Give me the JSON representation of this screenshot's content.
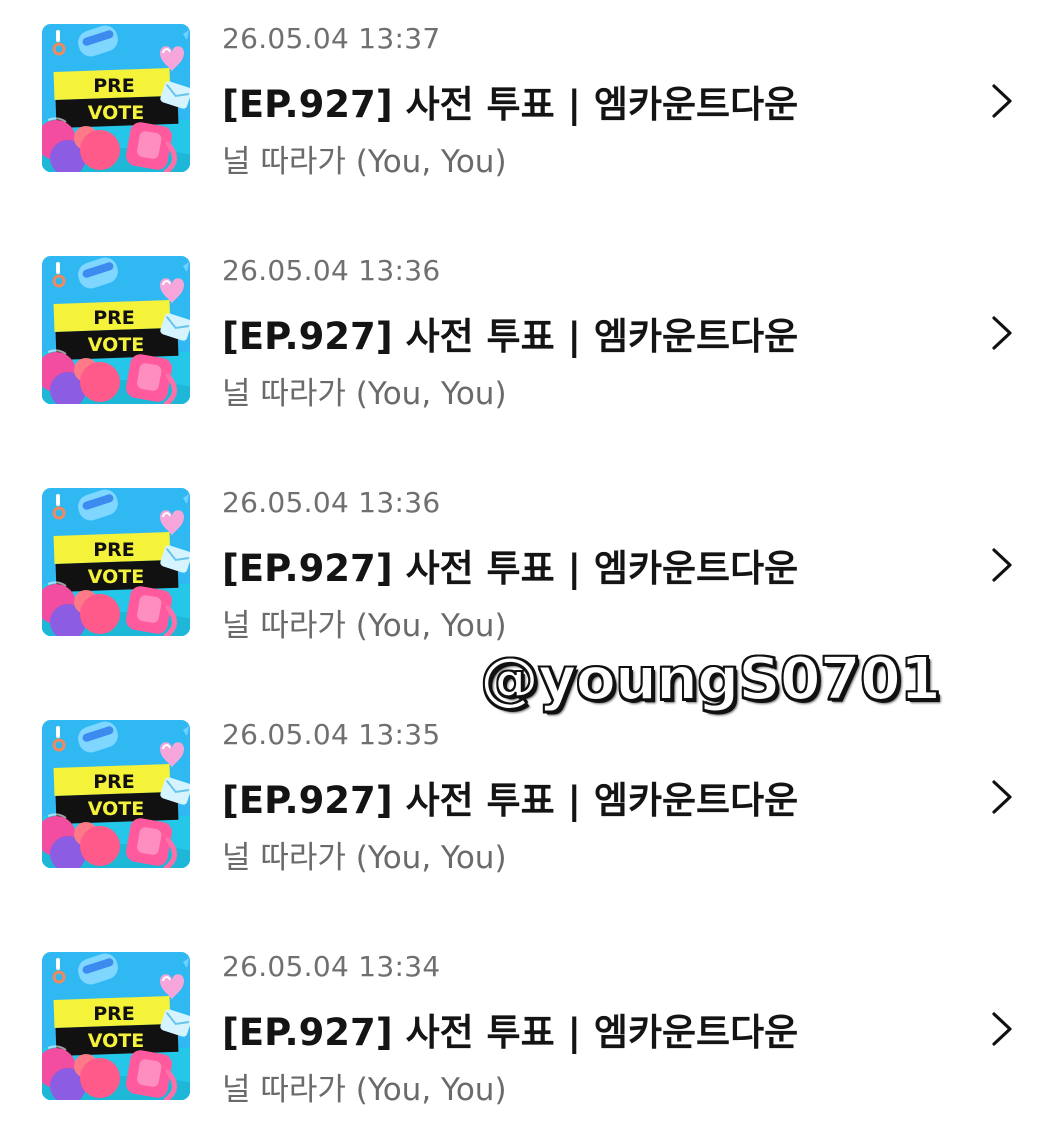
{
  "items": [
    {
      "timestamp": "26.05.04 13:37",
      "title": "[EP.927] 사전 투표 | 엠카운트다운",
      "subtitle": "널 따라가 (You, You)",
      "thumbnail": {
        "line1": "PRE",
        "line2": "VOTE"
      },
      "chevron_icon": "chevron-right-icon"
    },
    {
      "timestamp": "26.05.04 13:36",
      "title": "[EP.927] 사전 투표 | 엠카운트다운",
      "subtitle": "널 따라가 (You, You)",
      "thumbnail": {
        "line1": "PRE",
        "line2": "VOTE"
      },
      "chevron_icon": "chevron-right-icon"
    },
    {
      "timestamp": "26.05.04 13:36",
      "title": "[EP.927] 사전 투표 | 엠카운트다운",
      "subtitle": "널 따라가 (You, You)",
      "thumbnail": {
        "line1": "PRE",
        "line2": "VOTE"
      },
      "chevron_icon": "chevron-right-icon"
    },
    {
      "timestamp": "26.05.04 13:35",
      "title": "[EP.927] 사전 투표 | 엠카운트다운",
      "subtitle": "널 따라가 (You, You)",
      "thumbnail": {
        "line1": "PRE",
        "line2": "VOTE"
      },
      "chevron_icon": "chevron-right-icon"
    },
    {
      "timestamp": "26.05.04 13:34",
      "title": "[EP.927] 사전 투표 | 엠카운트다운",
      "subtitle": "널 따라가 (You, You)",
      "thumbnail": {
        "line1": "PRE",
        "line2": "VOTE"
      },
      "chevron_icon": "chevron-right-icon"
    }
  ],
  "watermark": "@youngS0701",
  "colors": {
    "thumb_background": "#2fb8f2",
    "thumb_banner_yellow": "#f5f23a",
    "thumb_banner_black": "#111111",
    "heart_pink": "#f7a6dc",
    "timestamp_gray": "#707070",
    "title_black": "#141414",
    "subtitle_gray": "#6a6a6a"
  }
}
